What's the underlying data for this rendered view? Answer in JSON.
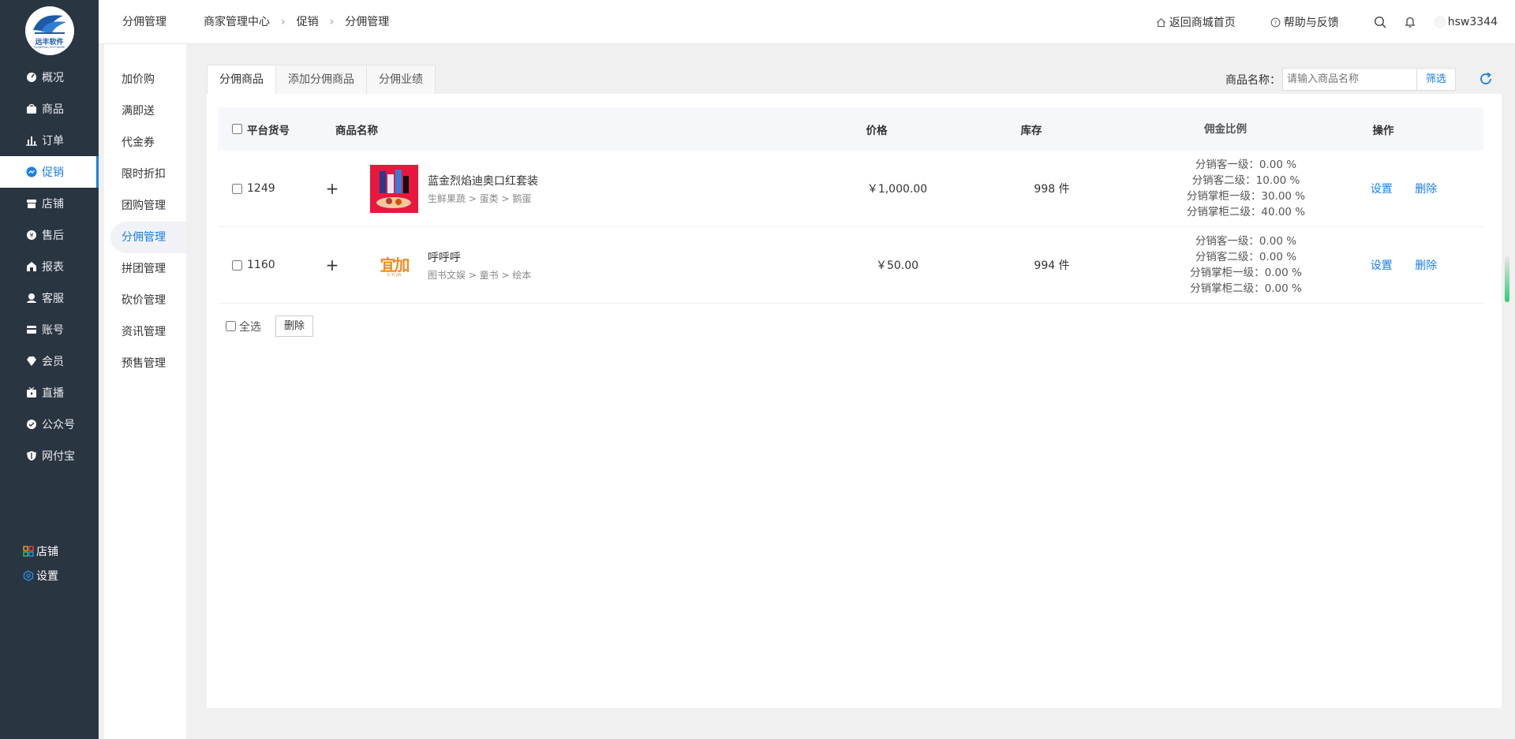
{
  "logo": {
    "text": "远丰软件",
    "sub": "YUANFENG SOFTWARE"
  },
  "sidebar": {
    "items": [
      {
        "label": "概况",
        "icon": "dashboard-icon"
      },
      {
        "label": "商品",
        "icon": "goods-icon"
      },
      {
        "label": "订单",
        "icon": "order-chart-icon"
      },
      {
        "label": "促销",
        "icon": "promotion-icon",
        "active": true
      },
      {
        "label": "店铺",
        "icon": "store-icon"
      },
      {
        "label": "售后",
        "icon": "aftersale-icon"
      },
      {
        "label": "报表",
        "icon": "report-icon"
      },
      {
        "label": "客服",
        "icon": "service-icon"
      },
      {
        "label": "账号",
        "icon": "account-icon"
      },
      {
        "label": "会员",
        "icon": "member-icon"
      },
      {
        "label": "直播",
        "icon": "live-icon"
      },
      {
        "label": "公众号",
        "icon": "official-account-icon"
      },
      {
        "label": "网付宝",
        "icon": "payment-shield-icon"
      }
    ],
    "bottom": [
      {
        "label": "店铺",
        "icon": "grid-apps-icon"
      },
      {
        "label": "设置",
        "icon": "settings-hex-icon"
      }
    ]
  },
  "header": {
    "title": "分佣管理",
    "breadcrumbs": [
      "商家管理中心",
      "促销",
      "分佣管理"
    ],
    "home_link": "返回商城首页",
    "help_link": "帮助与反馈",
    "username": "hsw3344"
  },
  "submenu": {
    "items": [
      "加价购",
      "满即送",
      "代金券",
      "限时折扣",
      "团购管理",
      "分佣管理",
      "拼团管理",
      "砍价管理",
      "资讯管理",
      "预售管理"
    ],
    "active_index": 5
  },
  "tabs": [
    {
      "label": "分佣商品",
      "active": true
    },
    {
      "label": "添加分佣商品"
    },
    {
      "label": "分佣业绩"
    }
  ],
  "filter": {
    "label": "商品名称：",
    "placeholder": "请输入商品名称",
    "button": "筛选"
  },
  "table": {
    "headers": {
      "id": "平台货号",
      "name": "商品名称",
      "price": "价格",
      "stock": "库存",
      "ratio": "佣金比例",
      "op": "操作"
    },
    "rows": [
      {
        "id": "1249",
        "expand": "+",
        "name": "蓝金烈焰迪奥口红套装",
        "category": "生鲜果蔬 > 蛋类 > 鹅蛋",
        "price": "￥1,000.00",
        "stock": "998 件",
        "ratios": [
          "分销客一级：0.00 %",
          "分销客二级：10.00 %",
          "分销掌柜一级：30.00 %",
          "分销掌柜二级：40.00 %"
        ],
        "op_set": "设置",
        "op_delete": "删除"
      },
      {
        "id": "1160",
        "expand": "+",
        "name": "呼呼呼",
        "category": "图书文娱 > 童书 > 绘本",
        "price": "￥50.00",
        "stock": "994 件",
        "ratios": [
          "分销客一级：0.00 %",
          "分销客二级：0.00 %",
          "分销掌柜一级：0.00 %",
          "分销掌柜二级：0.00 %"
        ],
        "op_set": "设置",
        "op_delete": "删除",
        "thumb_text": "宜加",
        "thumb_sub": "G YI JIA"
      }
    ]
  },
  "footer": {
    "select_all": "全选",
    "delete": "删除"
  },
  "colors": {
    "sidebar": "#2a3542",
    "accent": "#1a7ee6"
  }
}
